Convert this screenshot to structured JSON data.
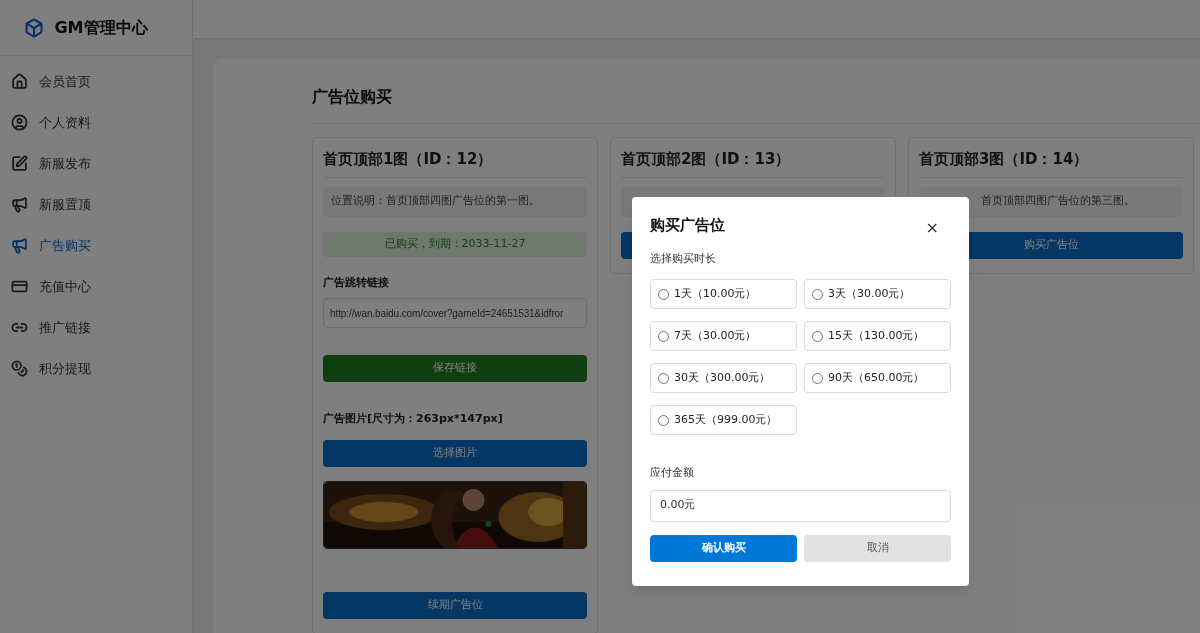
{
  "brand": {
    "name": "GM管理中心"
  },
  "sidebar": {
    "items": [
      {
        "label": "会员首页",
        "selected": false
      },
      {
        "label": "个人资料",
        "selected": false
      },
      {
        "label": "新服发布",
        "selected": false
      },
      {
        "label": "新服置顶",
        "selected": false
      },
      {
        "label": "广告购买",
        "selected": true
      },
      {
        "label": "充值中心",
        "selected": false
      },
      {
        "label": "推广链接",
        "selected": false
      },
      {
        "label": "积分提现",
        "selected": false
      }
    ]
  },
  "page": {
    "title": "广告位购买"
  },
  "cards": [
    {
      "kind": "purchased",
      "title": "首页顶部1图（ID：12）",
      "description": "位置说明：首页顶部四图广告位的第一图。",
      "status": "已购买，到期：2033-11-27",
      "link_label": "广告跳转链接",
      "link_value": "http://wan.baidu.com/cover?gameId=24651531&idfror",
      "save_button": "保存链接",
      "image_label": "广告图片[尺寸为：263px*147px]",
      "choose_button": "选择图片",
      "renew_button": "续期广告位"
    },
    {
      "kind": "available",
      "title": "首页顶部2图（ID：13）"
    },
    {
      "kind": "available",
      "title": "首页顶部3图（ID：14）",
      "description": "首页顶部四图广告位的第三图。",
      "buy_button": "购买广告位"
    }
  ],
  "dialog": {
    "title": "购买广告位",
    "close": "×",
    "duration_label": "选择购买时长",
    "options": [
      {
        "label": "1天（10.00元）",
        "selected": false
      },
      {
        "label": "3天（30.00元）",
        "selected": false
      },
      {
        "label": "7天（30.00元）",
        "selected": false
      },
      {
        "label": "15天（130.00元）",
        "selected": false
      },
      {
        "label": "30天（300.00元）",
        "selected": false
      },
      {
        "label": "90天（650.00元）",
        "selected": false
      },
      {
        "label": "365天（999.00元）",
        "selected": false
      }
    ],
    "amount_label": "应付金额",
    "amount_value": "0.00元",
    "confirm_button": "确认购买",
    "cancel_button": "取消"
  }
}
